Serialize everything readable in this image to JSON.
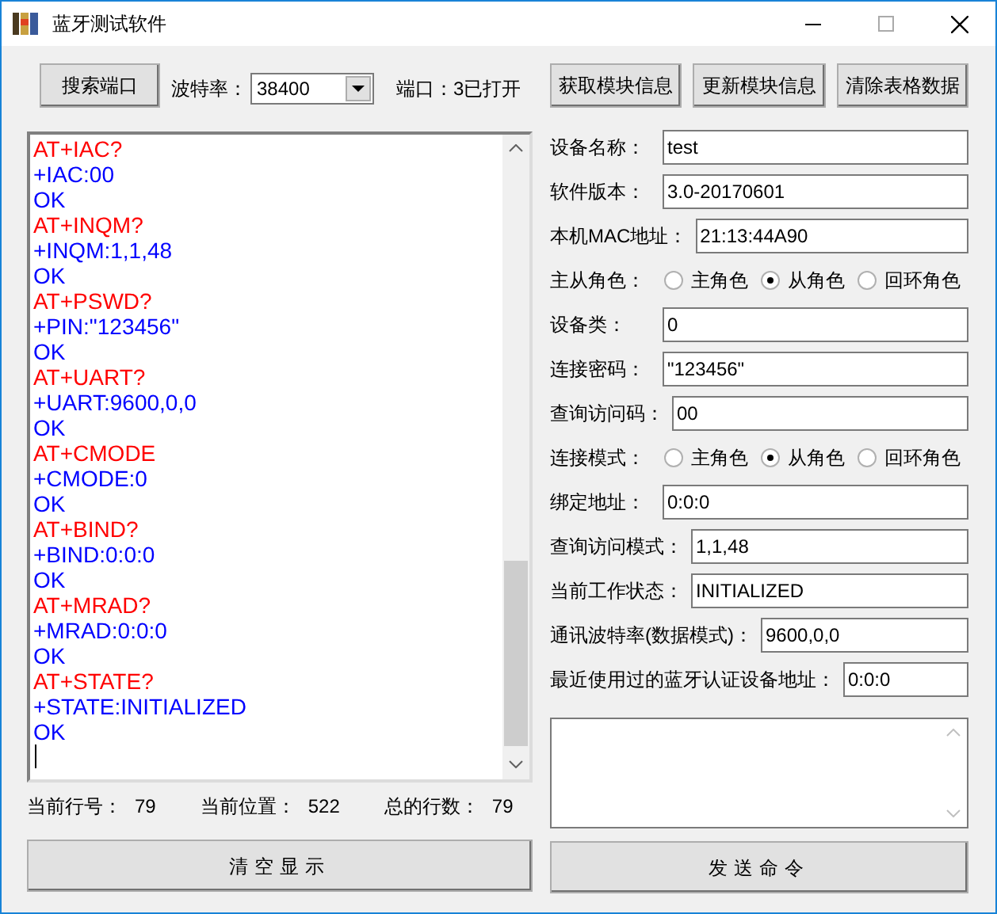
{
  "window": {
    "title": "蓝牙测试软件"
  },
  "toolbar": {
    "search_button": "搜索端口",
    "baud_label": "波特率：",
    "baud_value": "38400",
    "port_status": "端口：3已打开"
  },
  "actions": [
    "获取模块信息",
    "更新模块信息",
    "清除表格数据"
  ],
  "log": [
    {
      "kind": "command",
      "text": "AT+IAC?"
    },
    {
      "kind": "response",
      "text": "+IAC:00"
    },
    {
      "kind": "response",
      "text": "OK"
    },
    {
      "kind": "command",
      "text": "AT+INQM?"
    },
    {
      "kind": "response",
      "text": "+INQM:1,1,48"
    },
    {
      "kind": "response",
      "text": "OK"
    },
    {
      "kind": "command",
      "text": "AT+PSWD?"
    },
    {
      "kind": "response",
      "text": "+PIN:\"123456\""
    },
    {
      "kind": "response",
      "text": "OK"
    },
    {
      "kind": "command",
      "text": "AT+UART?"
    },
    {
      "kind": "response",
      "text": "+UART:9600,0,0"
    },
    {
      "kind": "response",
      "text": "OK"
    },
    {
      "kind": "command",
      "text": "AT+CMODE"
    },
    {
      "kind": "response",
      "text": "+CMODE:0"
    },
    {
      "kind": "response",
      "text": "OK"
    },
    {
      "kind": "command",
      "text": "AT+BIND?"
    },
    {
      "kind": "response",
      "text": "+BIND:0:0:0"
    },
    {
      "kind": "response",
      "text": "OK"
    },
    {
      "kind": "command",
      "text": "AT+MRAD?"
    },
    {
      "kind": "response",
      "text": "+MRAD:0:0:0"
    },
    {
      "kind": "response",
      "text": "OK"
    },
    {
      "kind": "command",
      "text": "AT+STATE?"
    },
    {
      "kind": "response",
      "text": "+STATE:INITIALIZED"
    },
    {
      "kind": "response",
      "text": "OK"
    }
  ],
  "status": [
    {
      "label": "当前行号：",
      "value": "79"
    },
    {
      "label": "当前位置：",
      "value": "522"
    },
    {
      "label": "总的行数：",
      "value": "79"
    }
  ],
  "form": [
    {
      "kind": "field",
      "label": "设备名称：",
      "value": "test"
    },
    {
      "kind": "field",
      "label": "软件版本：",
      "value": "3.0-20170601"
    },
    {
      "kind": "field",
      "label": "本机MAC地址：",
      "value": "21:13:44A90"
    },
    {
      "kind": "radio",
      "label": "主从角色：",
      "options": [
        {
          "label": "主角色",
          "selected": false
        },
        {
          "label": "从角色",
          "selected": true
        },
        {
          "label": "回环角色",
          "selected": false
        }
      ]
    },
    {
      "kind": "field",
      "label": "设备类：",
      "value": "0"
    },
    {
      "kind": "field",
      "label": "连接密码：",
      "value": "\"123456\""
    },
    {
      "kind": "field",
      "label": "查询访问码：",
      "value": "00"
    },
    {
      "kind": "radio",
      "label": "连接模式：",
      "options": [
        {
          "label": "主角色",
          "selected": false
        },
        {
          "label": "从角色",
          "selected": true
        },
        {
          "label": "回环角色",
          "selected": false
        }
      ]
    },
    {
      "kind": "field",
      "label": "绑定地址：",
      "value": "0:0:0"
    },
    {
      "kind": "field",
      "label": "查询访问模式：",
      "value": "1,1,48"
    },
    {
      "kind": "field",
      "label": "当前工作状态：",
      "value": "INITIALIZED"
    },
    {
      "kind": "field",
      "label": "通讯波特率(数据模式)：",
      "value": "9600,0,0"
    },
    {
      "kind": "field",
      "label": "最近使用过的蓝牙认证设备地址：",
      "value": "0:0:0"
    }
  ],
  "clear_button": "清空显示",
  "send_button": "发送命令"
}
